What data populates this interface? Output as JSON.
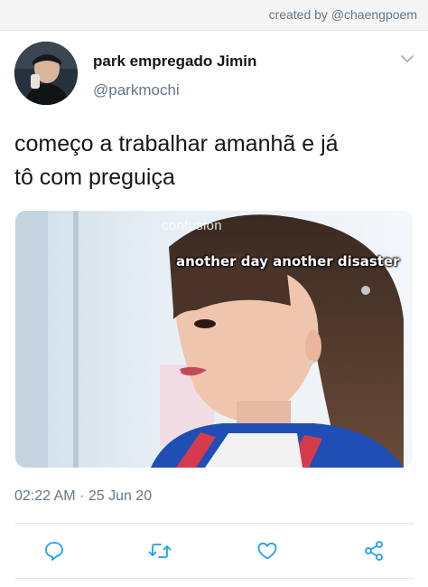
{
  "header": {
    "credit": "created by @chaengpoem"
  },
  "tweet": {
    "display_name": "park empregado Jimin",
    "handle": "@parkmochi",
    "text_lines": [
      "começo a trabalhar amanhã e já",
      "tô com preguiça"
    ],
    "media": {
      "watermark": "confusion",
      "caption": "another day another disaster"
    },
    "timestamp": "02:22 AM · 25 Jun 20"
  },
  "actions": [
    "reply-icon",
    "retweet-icon",
    "like-icon",
    "share-icon"
  ],
  "colors": {
    "secondary_text": "#657786",
    "icon": "#1da1f2",
    "divider": "#e1e8ed"
  }
}
